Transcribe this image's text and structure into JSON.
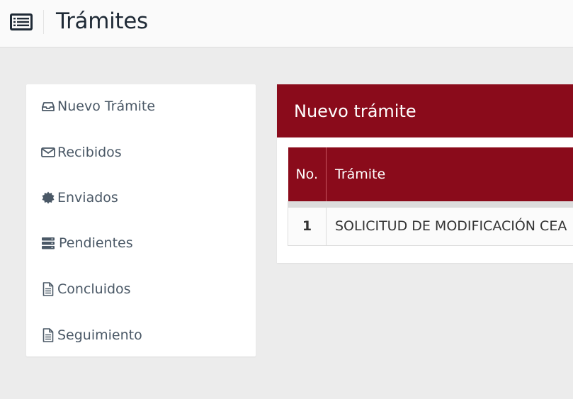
{
  "header": {
    "title": "Trámites",
    "menu_icon": "list-icon"
  },
  "sidebar": {
    "items": [
      {
        "label": "Nuevo Trámite",
        "icon": "inbox-icon"
      },
      {
        "label": "Recibidos",
        "icon": "envelope-icon"
      },
      {
        "label": "Enviados",
        "icon": "certificate-icon"
      },
      {
        "label": "Pendientes",
        "icon": "server-icon"
      },
      {
        "label": "Concluidos",
        "icon": "document-icon"
      },
      {
        "label": "Seguimiento",
        "icon": "document-icon"
      }
    ]
  },
  "panel": {
    "title": "Nuevo trámite",
    "table": {
      "headers": [
        "No.",
        "Trámite"
      ],
      "rows": [
        {
          "no": "1",
          "tramite": "SOLICITUD DE MODIFICACIÓN CEA"
        }
      ]
    }
  },
  "colors": {
    "accent": "#8a0b1b",
    "background": "#ececec",
    "text": "#4a5866"
  }
}
